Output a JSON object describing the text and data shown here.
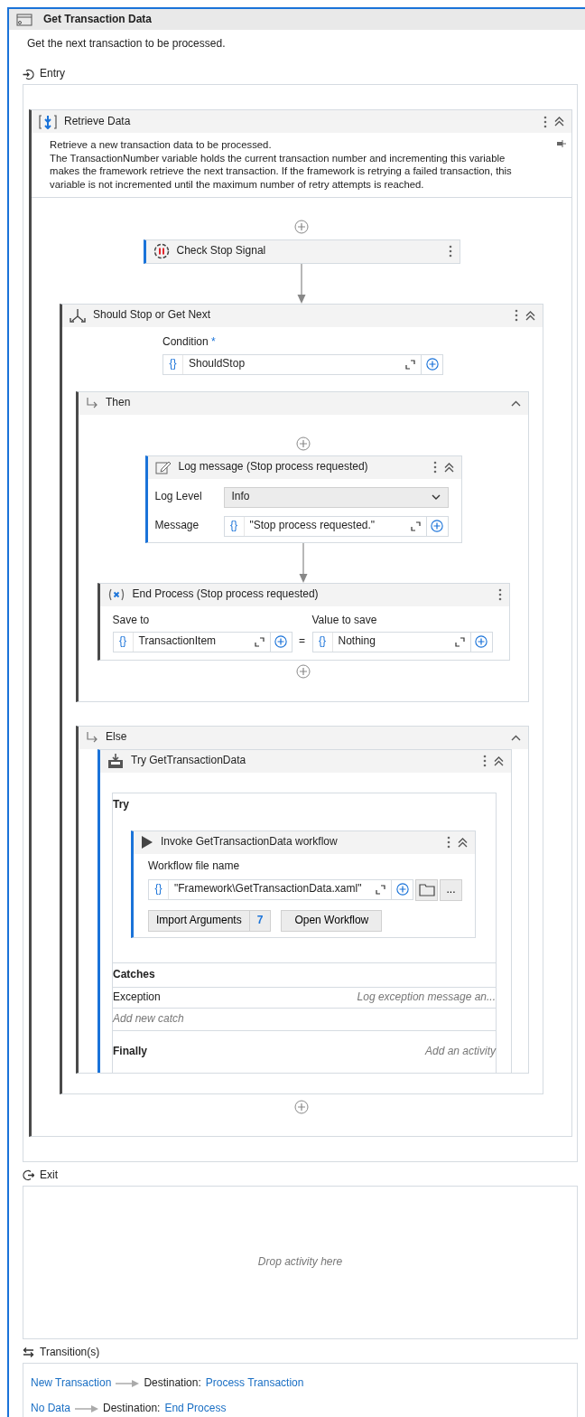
{
  "state": {
    "title": "Get Transaction Data",
    "description": "Get the next transaction to be processed."
  },
  "entry": {
    "label": "Entry",
    "sequence": {
      "title": "Retrieve Data",
      "annotation": [
        "Retrieve a new transaction data to be processed.",
        "The TransactionNumber variable holds the current transaction number and incrementing this variable makes the framework retrieve the next transaction. If the framework is retrying a failed transaction, this variable is not incremented until the maximum number of retry attempts is reached."
      ],
      "check_stop": {
        "title": "Check Stop Signal"
      },
      "if": {
        "title": "Should Stop or Get Next",
        "condition_label": "Condition",
        "required_mark": "*",
        "condition": {
          "prefix": "{}",
          "value": "ShouldStop"
        },
        "then": {
          "label": "Then",
          "log": {
            "title": "Log message (Stop process requested)",
            "level_label": "Log Level",
            "level": "Info",
            "message_label": "Message",
            "message": {
              "prefix": "{}",
              "value": "\"Stop process requested.\""
            }
          },
          "end": {
            "title": "End Process (Stop process requested)",
            "save_to_label": "Save to",
            "save_to": {
              "prefix": "{}",
              "value": "TransactionItem"
            },
            "equals": "=",
            "value_label": "Value to save",
            "value": {
              "prefix": "{}",
              "value": "Nothing"
            }
          }
        },
        "else": {
          "label": "Else",
          "try": {
            "title": "Try GetTransactionData",
            "try_label": "Try",
            "invoke": {
              "title": "Invoke GetTransactionData workflow",
              "file_label": "Workflow file name",
              "file": {
                "prefix": "{}",
                "value": "\"Framework\\GetTransactionData.xaml\""
              },
              "more": "...",
              "import_label": "Import Arguments",
              "import_count": "7",
              "open_label": "Open Workflow"
            },
            "catches_label": "Catches",
            "catches": [
              {
                "exception": "Exception",
                "handler": "Log exception message an..."
              }
            ],
            "add_catch": "Add new catch",
            "finally_label": "Finally",
            "finally_placeholder": "Add an activity"
          }
        }
      }
    }
  },
  "exit": {
    "label": "Exit",
    "placeholder": "Drop activity here"
  },
  "transitions": {
    "label": "Transition(s)",
    "items": [
      {
        "name": "New Transaction",
        "destination_label": "Destination:",
        "destination": "Process Transaction"
      },
      {
        "name": "No Data",
        "destination_label": "Destination:",
        "destination": "End Process"
      }
    ]
  }
}
